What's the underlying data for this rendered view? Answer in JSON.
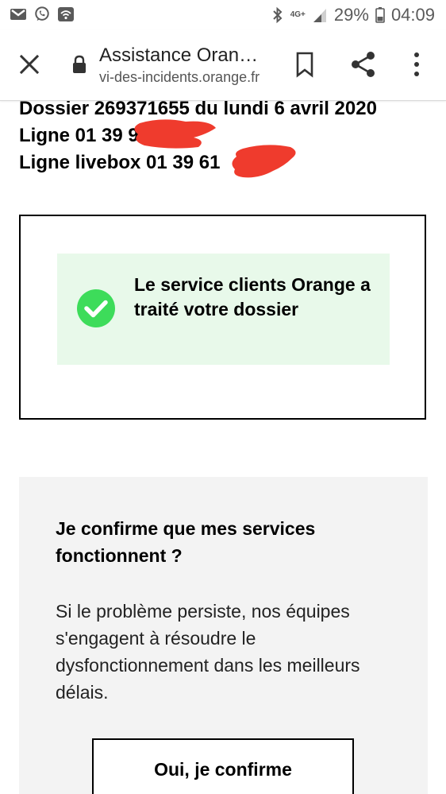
{
  "status_bar": {
    "network": "4G+",
    "battery": "29%",
    "time": "04:09",
    "icons": [
      "gmail-icon",
      "whatsapp-icon",
      "wifi-icon",
      "bluetooth-icon",
      "signal-icon",
      "battery-icon"
    ]
  },
  "toolbar": {
    "title": "Assistance Oran…",
    "url": "vi-des-incidents.orange.fr",
    "icons": [
      "close-icon",
      "lock-icon",
      "bookmark-icon",
      "share-icon",
      "more-menu-icon"
    ]
  },
  "dossier": {
    "line1": "Dossier 269371655 du lundi 6 avril 2020",
    "line2": "Ligne 01 39 9",
    "line3": "Ligne livebox 01 39 61"
  },
  "status_message": "Le service clients Orange a traité votre dossier",
  "confirm": {
    "title": "Je confirme que mes services fonctionnent ?",
    "description": "Si le problème persiste, nos équipes s'engagent à résoudre le dysfonctionnement dans les meilleurs délais.",
    "button_label": "Oui, je confirme"
  },
  "colors": {
    "success_green": "#3ddc5a",
    "success_panel_bg": "#e8f9ea",
    "redaction_red": "#ef3b2d",
    "confirm_panel_bg": "#f3f3f3"
  }
}
